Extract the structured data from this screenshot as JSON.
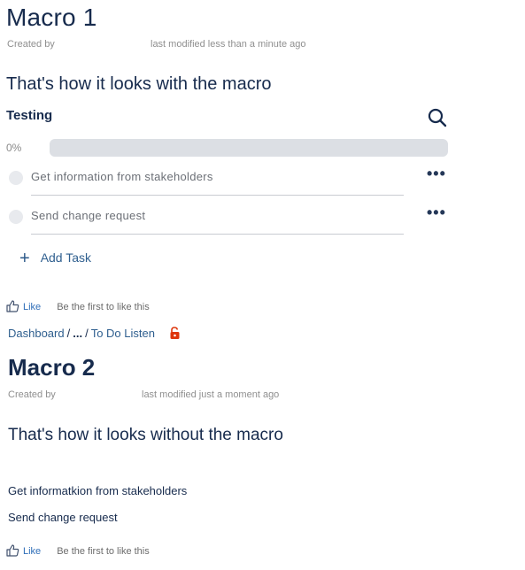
{
  "macro1": {
    "title": "Macro 1",
    "created_label": "Created by",
    "modified_text": "last modified less than a minute ago",
    "heading": "That's how it looks with the macro",
    "board": {
      "title": "Testing",
      "progress_text": "0%",
      "progress_value": 0,
      "tasks": [
        {
          "label": "Get information from stakeholders",
          "more": "•••"
        },
        {
          "label": "Send change request",
          "more": "•••"
        }
      ],
      "add_task_label": "Add Task",
      "add_task_icon": "+"
    },
    "like": {
      "label": "Like",
      "note": "Be the first to like this"
    }
  },
  "breadcrumb": {
    "items": [
      "Dashboard",
      "...",
      "To Do Listen"
    ],
    "separator": "/"
  },
  "macro2": {
    "title": "Macro 2",
    "created_label": "Created by",
    "modified_text": "last modified just a moment ago",
    "heading": "That's how it looks without the macro",
    "items": [
      "Get informatkion from stakeholders",
      "Send change request"
    ],
    "like": {
      "label": "Like",
      "note": "Be the first to like this"
    }
  },
  "colors": {
    "text": "#172b4d",
    "link": "#2f5f8f",
    "progress_track": "#dcdfe4",
    "lock_icon": "#de350b"
  },
  "icons": {
    "search": "search-icon",
    "like": "thumbs-up-icon",
    "lock": "unlocked-padlock-icon",
    "more": "more-icon",
    "add": "plus-icon"
  }
}
